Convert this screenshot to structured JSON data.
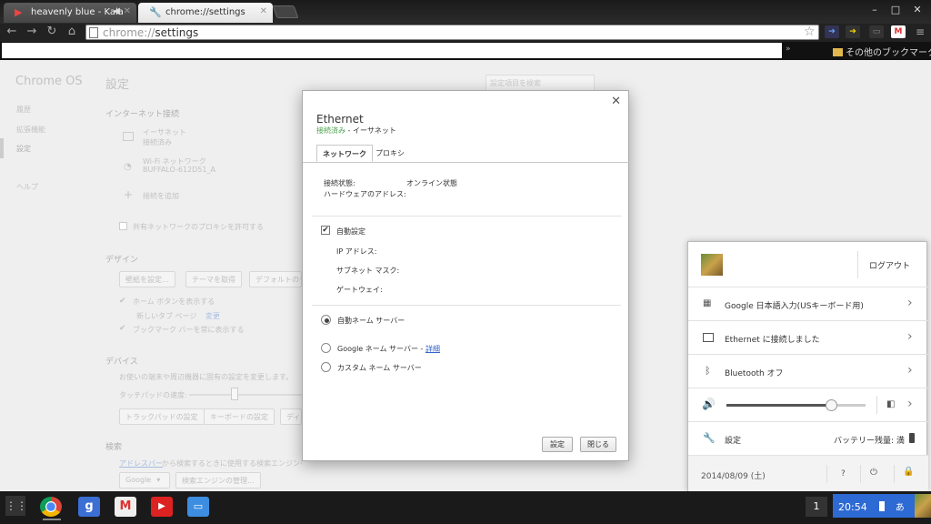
{
  "browser": {
    "tabs": [
      {
        "title": "heavenly blue - Kala",
        "icon": "youtube-icon"
      },
      {
        "title": "chrome://settings",
        "icon": "wrench-icon"
      }
    ],
    "url_scheme": "chrome://",
    "url_path": "settings",
    "other_bookmarks": "その他のブックマーク"
  },
  "settings": {
    "os_title": "Chrome OS",
    "nav": [
      "履歴",
      "拡張機能",
      "設定",
      "ヘルプ"
    ],
    "page_title": "設定",
    "search_placeholder": "設定項目を検索",
    "internet": {
      "heading": "インターネット接続",
      "ethernet_name": "イーサネット",
      "ethernet_status": "接続済み",
      "wifi_name": "Wi-Fi ネットワーク",
      "wifi_ssid": "BUFFALO-612D51_A",
      "add_connection": "接続を追加",
      "proxy_checkbox": "共有ネットワークのプロキシを許可する"
    },
    "design": {
      "heading": "デザイン",
      "wallpaper_button": "壁紙を設定...",
      "theme_button": "テーマを取得",
      "default_button": "デフォルトのテ",
      "home_button_checkbox": "ホーム ボタンを表示する",
      "new_tab_page": "新しいタブ ページ",
      "change_link": "変更",
      "bookmark_bar_checkbox": "ブックマーク バーを常に表示する"
    },
    "device": {
      "heading": "デバイス",
      "description": "お使いの端末や周辺機器に固有の設定を変更します。",
      "touchpad_speed": "タッチパッドの速度:",
      "touchpad_button": "トラックパッドの設定",
      "keyboard_button": "キーボードの設定",
      "display_button": "ディ"
    },
    "search": {
      "heading": "検索",
      "address_bar_link": "アドレスバー",
      "description": "から検索するときに使用する検索エンジンを設定します。",
      "engine_select": "Google",
      "manage_button": "検索エンジンの管理..."
    }
  },
  "dialog": {
    "title": "Ethernet",
    "status_connected": "接続済み",
    "status_sep": " - ",
    "status_type": "イーサネット",
    "tab_network": "ネットワーク",
    "tab_proxy": "プロキシ",
    "connection_state_label": "接続状態:",
    "connection_state_value": "オンライン状態",
    "hardware_address_label": "ハードウェアのアドレス:",
    "auto_config": "自動設定",
    "ip_address": "IP アドレス:",
    "subnet_mask": "サブネット マスク:",
    "gateway": "ゲートウェイ:",
    "dns_auto": "自動ネーム サーバー",
    "dns_google": "Google ネーム サーバー",
    "dns_google_sep": " - ",
    "dns_google_details": "詳細",
    "dns_custom": "カスタム ネーム サーバー",
    "button_set": "設定",
    "button_close": "閉じる"
  },
  "tray": {
    "logout": "ログアウト",
    "ime": "Google 日本語入力(USキーボード用)",
    "ethernet": "Ethernet に接続しました",
    "bluetooth": "Bluetooth オフ",
    "volume_percent": 75,
    "settings": "設定",
    "battery": "バッテリー残量: 満",
    "date": "2014/08/09 (土)",
    "help": "?"
  },
  "shelf": {
    "apps": [
      "chrome-icon",
      "google-search-icon",
      "gmail-icon",
      "youtube-icon",
      "files-icon"
    ],
    "window_count": "1",
    "time": "20:54",
    "ime_indicator": "あ"
  },
  "colors": {
    "accent": "#2e6ad3",
    "connected": "#4ba24e",
    "link": "#3366cc"
  }
}
